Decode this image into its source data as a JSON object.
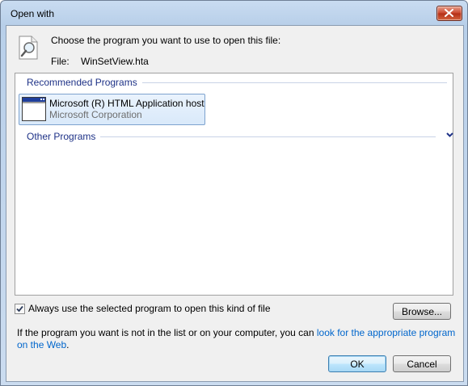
{
  "window": {
    "title": "Open with"
  },
  "header": {
    "prompt": "Choose the program you want to use to open this file:",
    "file_label": "File:",
    "file_name": "WinSetView.hta"
  },
  "groups": {
    "recommended_label": "Recommended Programs",
    "other_label": "Other Programs"
  },
  "programs": [
    {
      "name": "Microsoft (R) HTML Application host",
      "company": "Microsoft Corporation",
      "selected": true
    }
  ],
  "options": {
    "always_use_label": "Always use the selected program to open this kind of file",
    "always_use_checked": true
  },
  "buttons": {
    "browse": "Browse...",
    "ok": "OK",
    "cancel": "Cancel"
  },
  "help": {
    "text": "If the program you want is not in the list or on your computer, you can ",
    "link_text": "look for the appropriate program on the Web",
    "suffix": "."
  },
  "icons": {
    "document": "document-magnifier-icon",
    "program": "application-window-icon",
    "close": "close-icon",
    "expand": "chevron-down-icon"
  },
  "colors": {
    "group_header": "#1e3287",
    "link": "#0066cc",
    "close_button": "#c9442a"
  }
}
